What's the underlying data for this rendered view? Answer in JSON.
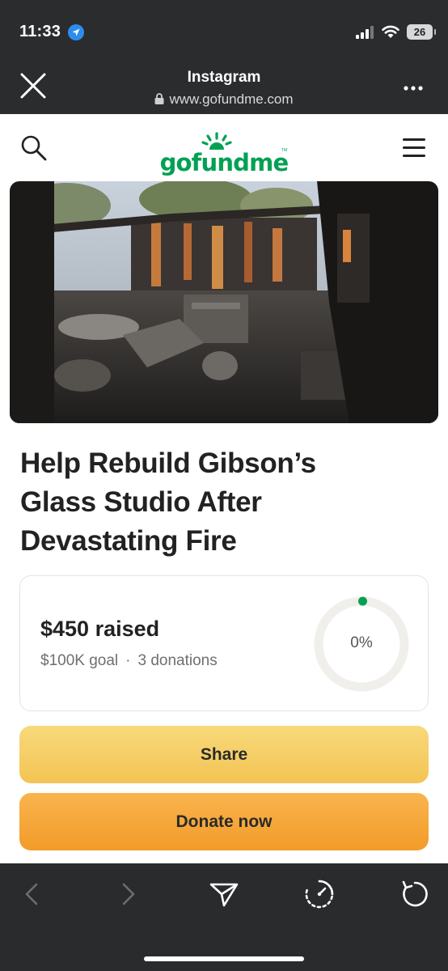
{
  "status_bar": {
    "time": "11:33",
    "battery": "26"
  },
  "browser": {
    "title": "Instagram",
    "url": "www.gofundme.com"
  },
  "site": {
    "logo": "gofundme",
    "logo_tm": "TM"
  },
  "campaign": {
    "title_lines": [
      "Help Rebuild Gibson’s",
      "Glass Studio After",
      "Devastating Fire"
    ],
    "raised": "$450 raised",
    "goal": "$100K goal",
    "separator": "·",
    "donations": "3 donations",
    "percent": "0%",
    "progress_fraction": 0.0045
  },
  "actions": {
    "share": "Share",
    "donate": "Donate now"
  },
  "colors": {
    "brand_green": "#01a153",
    "share_yellow": "#f6cf66",
    "donate_orange": "#f6a73a",
    "dark_chrome": "#2b2c2e"
  },
  "icons": {
    "location": "location-arrow-icon",
    "close": "close-icon",
    "lock": "lock-icon",
    "more": "more-icon",
    "search": "search-icon",
    "menu": "menu-icon",
    "back": "back-icon",
    "forward": "forward-icon",
    "share": "send-icon",
    "speed": "speedometer-icon",
    "reload": "reload-icon"
  }
}
